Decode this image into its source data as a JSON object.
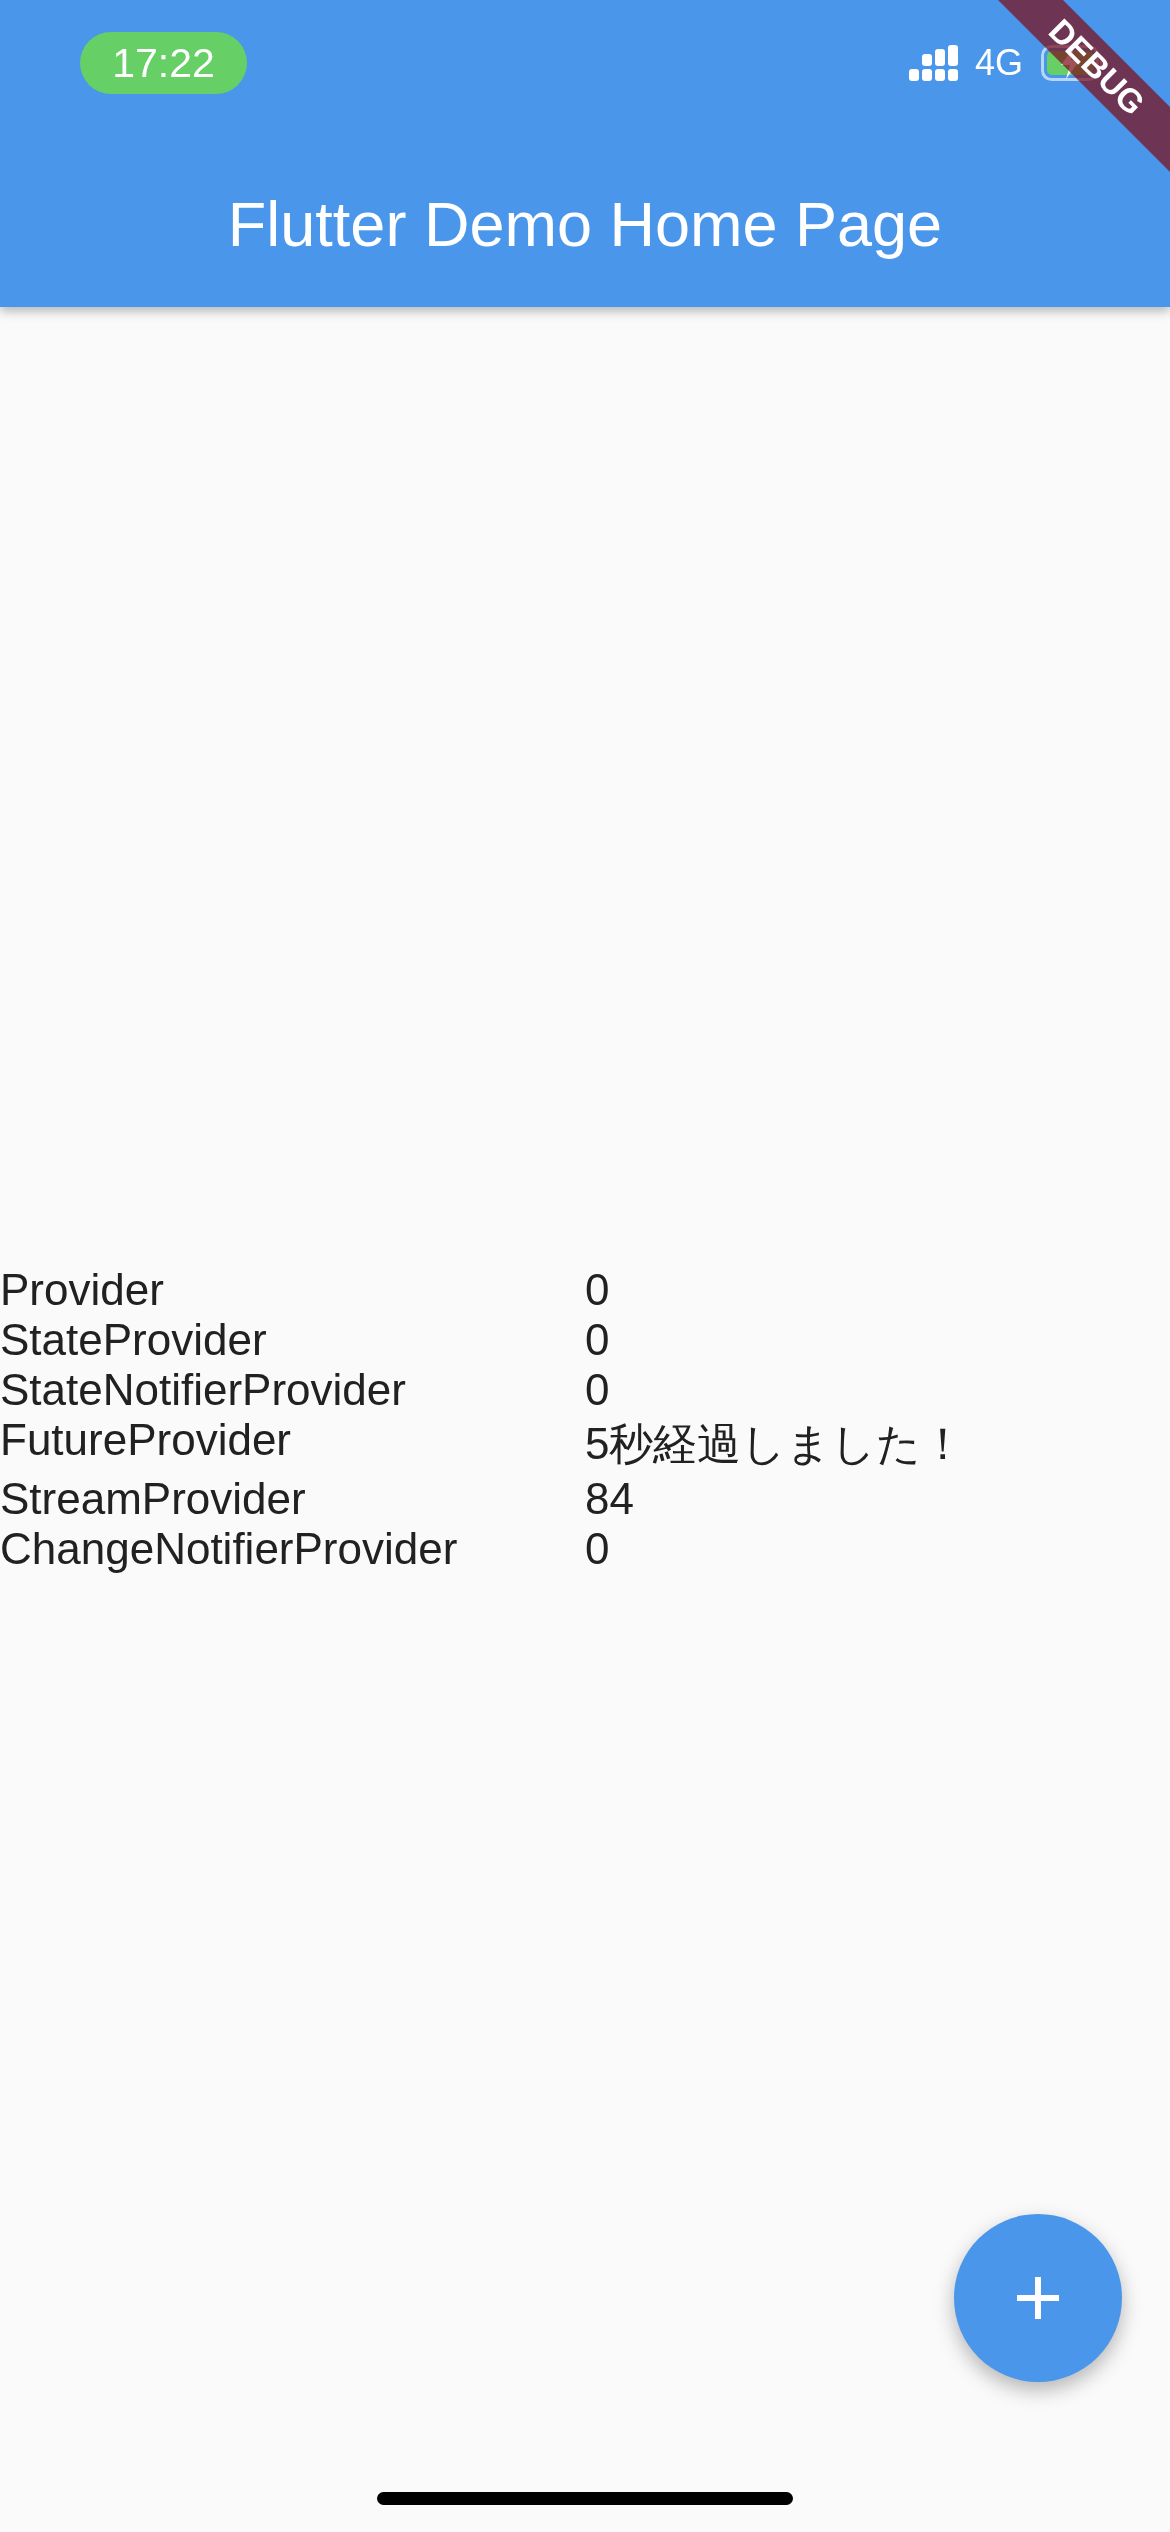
{
  "status_bar": {
    "time": "17:22",
    "network": "4G"
  },
  "app_bar": {
    "title": "Flutter Demo Home Page",
    "debug_banner": "DEBUG"
  },
  "table": {
    "rows": [
      {
        "label": "Provider",
        "value": "0"
      },
      {
        "label": "StateProvider",
        "value": "0"
      },
      {
        "label": "StateNotifierProvider",
        "value": "0"
      },
      {
        "label": "FutureProvider",
        "value": "5秒経過しました！"
      },
      {
        "label": "StreamProvider",
        "value": "84"
      },
      {
        "label": "ChangeNotifierProvider",
        "value": "0"
      }
    ]
  }
}
